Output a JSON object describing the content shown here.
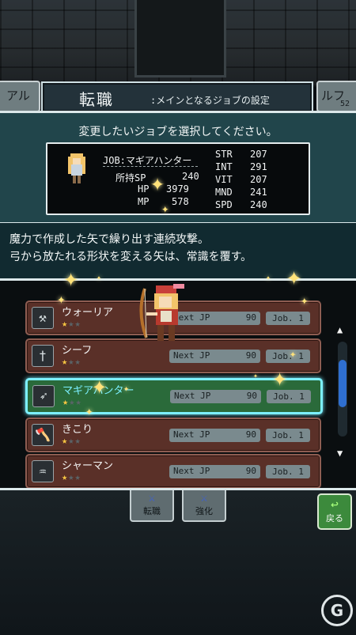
{
  "header": {
    "title": "転職",
    "subtitle": ":メインとなるジョブの設定",
    "left_card": "アル",
    "right_card": "ルフ",
    "right_card_level": "52"
  },
  "prompt": "変更したいジョブを選択してください。",
  "character": {
    "job_line": "JOB:マギアハンター",
    "sp_label": "所持SP",
    "sp_value": "240",
    "hp_label": "HP",
    "hp_value": "3979",
    "mp_label": "MP",
    "mp_value": "578",
    "stats": [
      {
        "name": "STR",
        "value": "207"
      },
      {
        "name": "INT",
        "value": "291"
      },
      {
        "name": "VIT",
        "value": "207"
      },
      {
        "name": "MND",
        "value": "241"
      },
      {
        "name": "SPD",
        "value": "240"
      }
    ]
  },
  "description": {
    "line1": "魔力で作成した矢で繰り出す連続攻撃。",
    "line2": "弓から放たれる形状を変える矢は、常識を覆す。"
  },
  "jobs": [
    {
      "name": "ウォーリア",
      "stars": 1,
      "jp_label": "Next JP",
      "jp_value": "90",
      "level": "Job. 1",
      "icon": "hammer-icon",
      "icon_glyph": "⚒"
    },
    {
      "name": "シーフ",
      "stars": 1,
      "jp_label": "Next JP",
      "jp_value": "90",
      "level": "Job. 1",
      "icon": "dagger-icon",
      "icon_glyph": "†"
    },
    {
      "name": "マギアハンター",
      "stars": 1,
      "jp_label": "Next JP",
      "jp_value": "90",
      "level": "Job. 1",
      "icon": "bow-icon",
      "icon_glyph": "➶",
      "selected": true
    },
    {
      "name": "きこり",
      "stars": 1,
      "jp_label": "Next JP",
      "jp_value": "90",
      "level": "Job. 1",
      "icon": "axe-icon",
      "icon_glyph": "🪓"
    },
    {
      "name": "シャーマン",
      "stars": 1,
      "jp_label": "Next JP",
      "jp_value": "90",
      "level": "Job. 1",
      "icon": "scroll-icon",
      "icon_glyph": "♒"
    }
  ],
  "star_max": 3,
  "bottom": {
    "tab_change": "転職",
    "tab_enhance": "強化",
    "back": "戻る"
  },
  "watermark": "G",
  "colors": {
    "selected_border": "#7cf0ff",
    "star": "#f5c542",
    "sparkle": "#ffe27a"
  }
}
